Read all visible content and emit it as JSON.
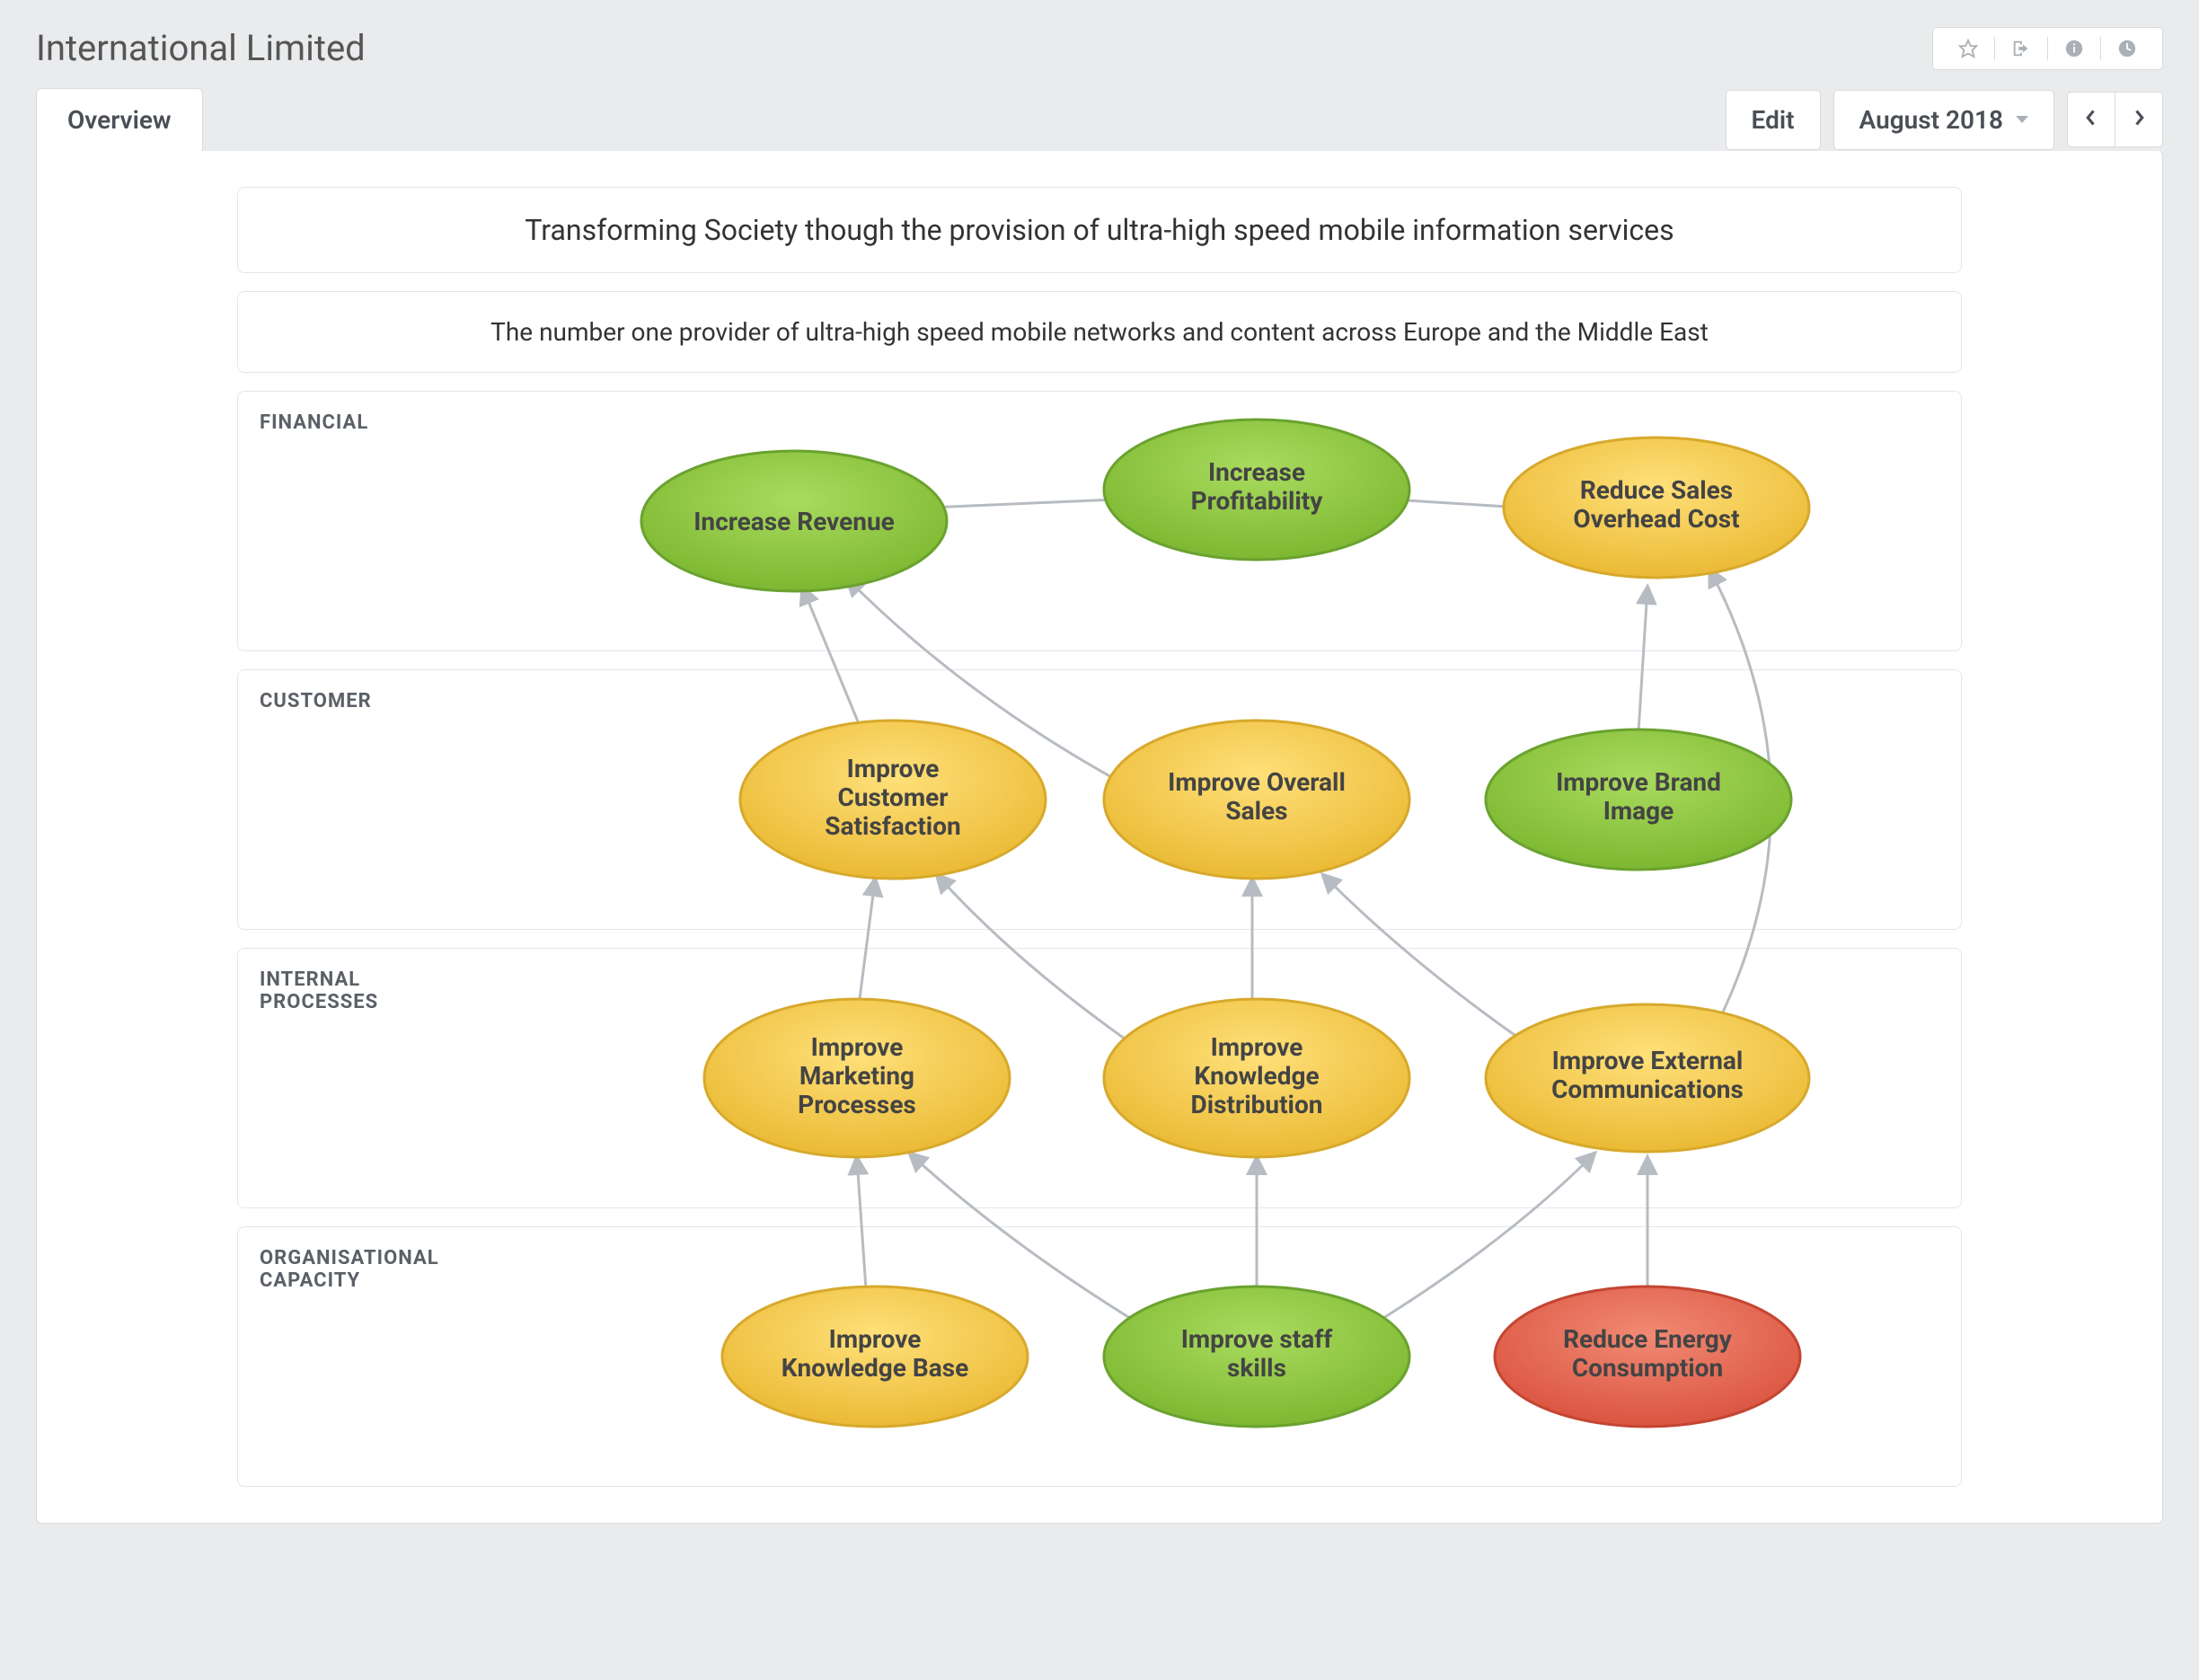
{
  "page": {
    "title": "International Limited",
    "tab_overview": "Overview",
    "edit": "Edit",
    "period": "August 2018"
  },
  "cards": {
    "mission": "Transforming Society though the provision of ultra-high speed mobile information services",
    "vision": "The number one provider of ultra-high speed mobile networks and content across Europe and the Middle East"
  },
  "perspectives": {
    "financial": "FINANCIAL",
    "customer": "CUSTOMER",
    "internal": "INTERNAL PROCESSES",
    "orgcap": "ORGANISATIONAL CAPACITY"
  },
  "nodes": {
    "revenue": "Increase Revenue",
    "profitability_l1": "Increase",
    "profitability_l2": "Profitability",
    "overhead_l1": "Reduce Sales",
    "overhead_l2": "Overhead Cost",
    "cust_sat_l1": "Improve",
    "cust_sat_l2": "Customer",
    "cust_sat_l3": "Satisfaction",
    "overall_sales_l1": "Improve Overall",
    "overall_sales_l2": "Sales",
    "brand_l1": "Improve Brand",
    "brand_l2": "Image",
    "marketing_l1": "Improve",
    "marketing_l2": "Marketing",
    "marketing_l3": "Processes",
    "knowledge_dist_l1": "Improve",
    "knowledge_dist_l2": "Knowledge",
    "knowledge_dist_l3": "Distribution",
    "ext_comm_l1": "Improve External",
    "ext_comm_l2": "Communications",
    "kb_l1": "Improve",
    "kb_l2": "Knowledge Base",
    "staff_l1": "Improve staff",
    "staff_l2": "skills",
    "energy_l1": "Reduce Energy",
    "energy_l2": "Consumption"
  },
  "colors": {
    "green_fill": "#8bc53f",
    "green_stroke": "#6aa22f",
    "yellow_fill": "#f3c843",
    "yellow_stroke": "#d7a92c",
    "red_fill": "#e25b47",
    "red_stroke": "#c44532",
    "arrow": "#b7bcc2"
  },
  "chart_data": {
    "type": "strategy_map",
    "perspectives": [
      "FINANCIAL",
      "CUSTOMER",
      "INTERNAL PROCESSES",
      "ORGANISATIONAL CAPACITY"
    ],
    "objectives": [
      {
        "id": "revenue",
        "label": "Increase Revenue",
        "perspective": "FINANCIAL",
        "status": "green"
      },
      {
        "id": "profitability",
        "label": "Increase Profitability",
        "perspective": "FINANCIAL",
        "status": "green"
      },
      {
        "id": "overhead",
        "label": "Reduce Sales Overhead Cost",
        "perspective": "FINANCIAL",
        "status": "yellow"
      },
      {
        "id": "customer_satisfaction",
        "label": "Improve Customer Satisfaction",
        "perspective": "CUSTOMER",
        "status": "yellow"
      },
      {
        "id": "overall_sales",
        "label": "Improve Overall Sales",
        "perspective": "CUSTOMER",
        "status": "yellow"
      },
      {
        "id": "brand_image",
        "label": "Improve Brand Image",
        "perspective": "CUSTOMER",
        "status": "green"
      },
      {
        "id": "marketing_processes",
        "label": "Improve Marketing Processes",
        "perspective": "INTERNAL PROCESSES",
        "status": "yellow"
      },
      {
        "id": "knowledge_distribution",
        "label": "Improve Knowledge Distribution",
        "perspective": "INTERNAL PROCESSES",
        "status": "yellow"
      },
      {
        "id": "external_communications",
        "label": "Improve External Communications",
        "perspective": "INTERNAL PROCESSES",
        "status": "yellow"
      },
      {
        "id": "knowledge_base",
        "label": "Improve Knowledge Base",
        "perspective": "ORGANISATIONAL CAPACITY",
        "status": "yellow"
      },
      {
        "id": "staff_skills",
        "label": "Improve staff skills",
        "perspective": "ORGANISATIONAL CAPACITY",
        "status": "green"
      },
      {
        "id": "energy_consumption",
        "label": "Reduce Energy Consumption",
        "perspective": "ORGANISATIONAL CAPACITY",
        "status": "red"
      }
    ],
    "links": [
      {
        "from": "revenue",
        "to": "profitability"
      },
      {
        "from": "overhead",
        "to": "profitability"
      },
      {
        "from": "customer_satisfaction",
        "to": "revenue"
      },
      {
        "from": "overall_sales",
        "to": "revenue"
      },
      {
        "from": "brand_image",
        "to": "overhead"
      },
      {
        "from": "external_communications",
        "to": "overhead"
      },
      {
        "from": "marketing_processes",
        "to": "customer_satisfaction"
      },
      {
        "from": "knowledge_distribution",
        "to": "customer_satisfaction"
      },
      {
        "from": "knowledge_distribution",
        "to": "overall_sales"
      },
      {
        "from": "external_communications",
        "to": "overall_sales"
      },
      {
        "from": "knowledge_base",
        "to": "marketing_processes"
      },
      {
        "from": "staff_skills",
        "to": "marketing_processes"
      },
      {
        "from": "staff_skills",
        "to": "knowledge_distribution"
      },
      {
        "from": "staff_skills",
        "to": "external_communications"
      },
      {
        "from": "energy_consumption",
        "to": "external_communications"
      }
    ]
  }
}
